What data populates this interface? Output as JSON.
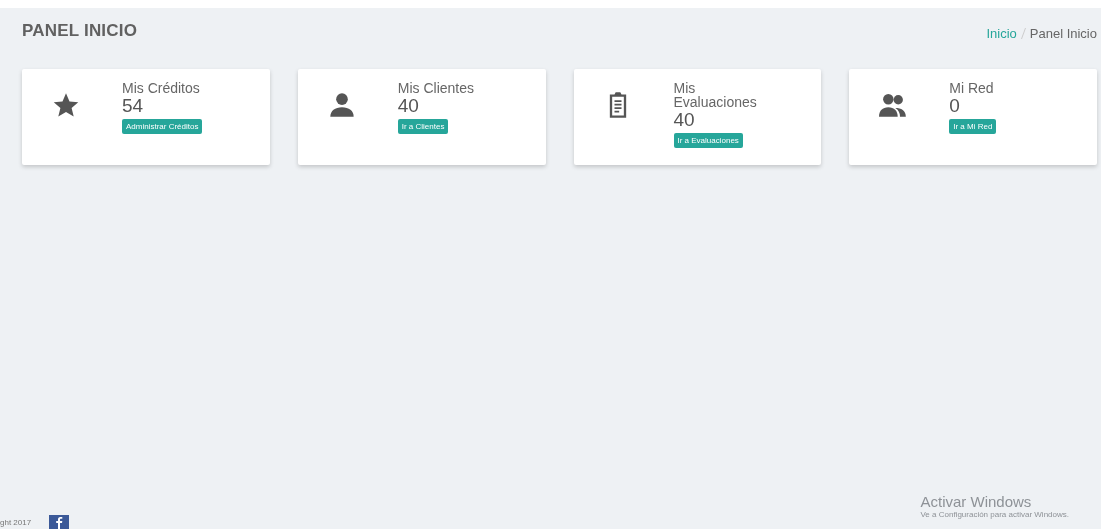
{
  "page_title": "PANEL INICIO",
  "breadcrumb": [
    {
      "label": "Inicio",
      "link": true
    },
    {
      "label": "Panel Inicio",
      "link": false
    }
  ],
  "cards": [
    {
      "kind": "star",
      "title": "Mis Créditos",
      "value": "54",
      "action": "Administrar Créditos"
    },
    {
      "kind": "user",
      "title": "Mis Clientes",
      "value": "40",
      "action": "Ir a Clientes"
    },
    {
      "kind": "clipboard",
      "title": "Mis Evaluaciones",
      "value": "40",
      "action": "Ir a Evaluaciones"
    },
    {
      "kind": "users",
      "title": "Mi Red",
      "value": "0",
      "action": "Ir a Mi Red"
    }
  ],
  "footer": {
    "copyright": "ght 2017"
  },
  "windows_notice": {
    "title": "Activar Windows",
    "text": "Ve a Configuración para activar Windows."
  }
}
